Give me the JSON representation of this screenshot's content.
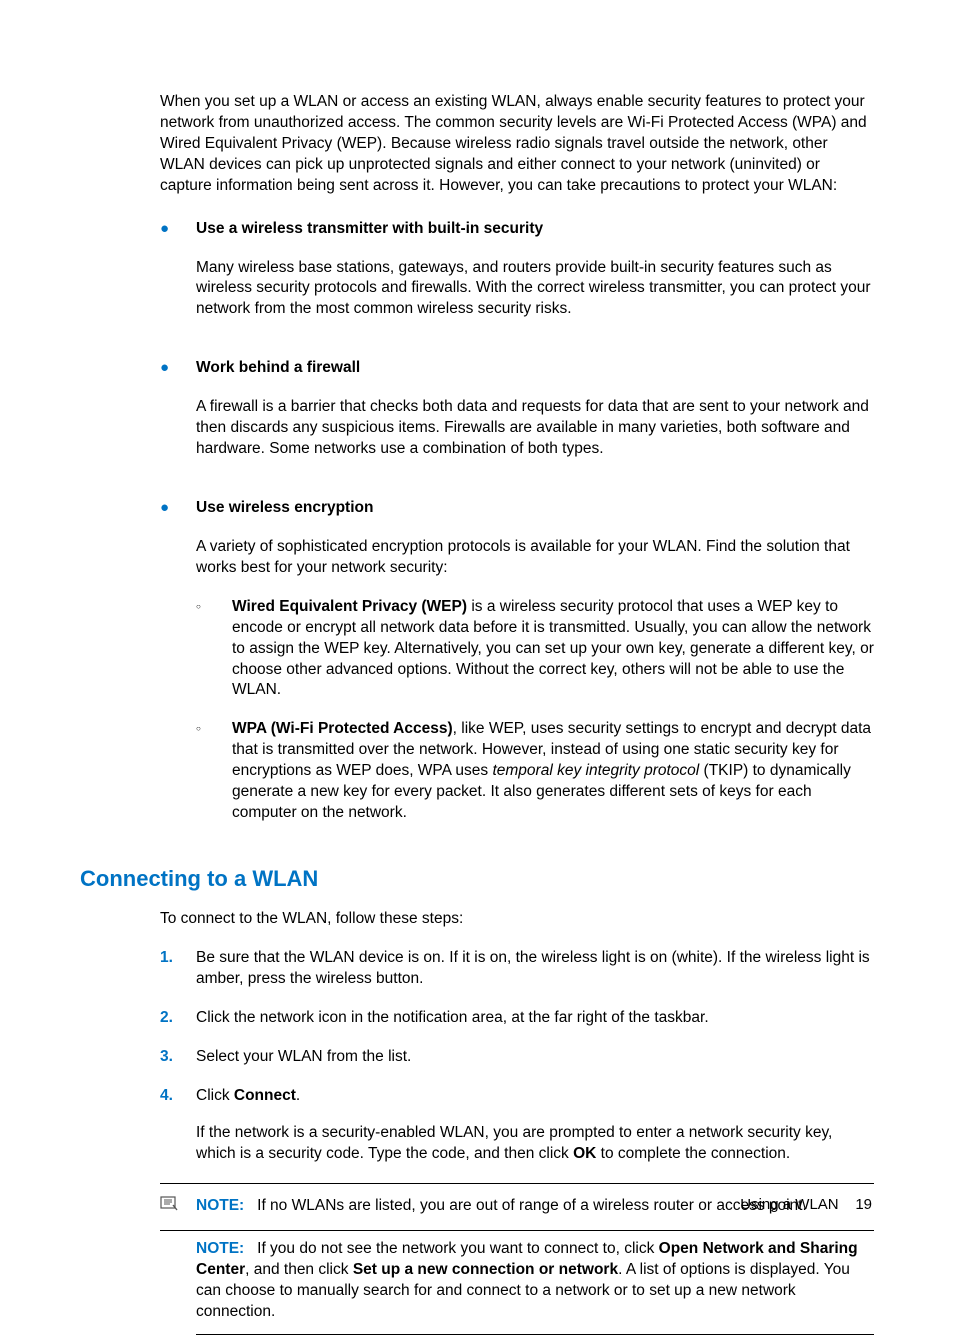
{
  "intro": "When you set up a WLAN or access an existing WLAN, always enable security features to protect your network from unauthorized access. The common security levels are Wi-Fi Protected Access (WPA) and Wired Equivalent Privacy (WEP). Because wireless radio signals travel outside the network, other WLAN devices can pick up unprotected signals and either connect to your network (uninvited) or capture information being sent across it. However, you can take precautions to protect your WLAN:",
  "bullets": [
    {
      "title": "Use a wireless transmitter with built-in security",
      "desc": "Many wireless base stations, gateways, and routers provide built-in security features such as wireless security protocols and firewalls. With the correct wireless transmitter, you can protect your network from the most common wireless security risks."
    },
    {
      "title": "Work behind a firewall",
      "desc": "A firewall is a barrier that checks both data and requests for data that are sent to your network and then discards any suspicious items. Firewalls are available in many varieties, both software and hardware. Some networks use a combination of both types."
    },
    {
      "title": "Use wireless encryption",
      "desc": "A variety of sophisticated encryption protocols is available for your WLAN. Find the solution that works best for your network security:"
    }
  ],
  "subBullets": [
    {
      "lead": "Wired Equivalent Privacy (WEP)",
      "rest": " is a wireless security protocol that uses a WEP key to encode or encrypt all network data before it is transmitted. Usually, you can allow the network to assign the WEP key. Alternatively, you can set up your own key, generate a different key, or choose other advanced options. Without the correct key, others will not be able to use the WLAN."
    },
    {
      "lead": "WPA (Wi-Fi Protected Access)",
      "restA": ", like WEP, uses security settings to encrypt and decrypt data that is transmitted over the network. However, instead of using one static security key for encryptions as WEP does, WPA uses ",
      "italic": "temporal key integrity protocol",
      "restB": " (TKIP) to dynamically generate a new key for every packet. It also generates different sets of keys for each computer on the network."
    }
  ],
  "heading": "Connecting to a WLAN",
  "stepsIntro": "To connect to the WLAN, follow these steps:",
  "steps": [
    "Be sure that the WLAN device is on. If it is on, the wireless light is on (white). If the wireless light is amber, press the wireless button.",
    "Click the network icon in the notification area, at the far right of the taskbar.",
    "Select your WLAN from the list."
  ],
  "step4": {
    "pre": "Click ",
    "bold": "Connect",
    "post": ".",
    "extraA": "If the network is a security-enabled WLAN, you are prompted to enter a network security key, which is a security code. Type the code, and then click ",
    "extraBold": "OK",
    "extraB": " to complete the connection."
  },
  "noteLabel": "NOTE:",
  "note1": "If no WLANs are listed, you are out of range of a wireless router or access point.",
  "note2": {
    "a": "If you do not see the network you want to connect to, click ",
    "b1": "Open Network and Sharing Center",
    "b": ", and then click ",
    "b2": "Set up a new connection or network",
    "c": ". A list of options is displayed. You can choose to manually search for and connect to a network or to set up a new network connection."
  },
  "footerText": "Using a WLAN",
  "pageNum": "19"
}
